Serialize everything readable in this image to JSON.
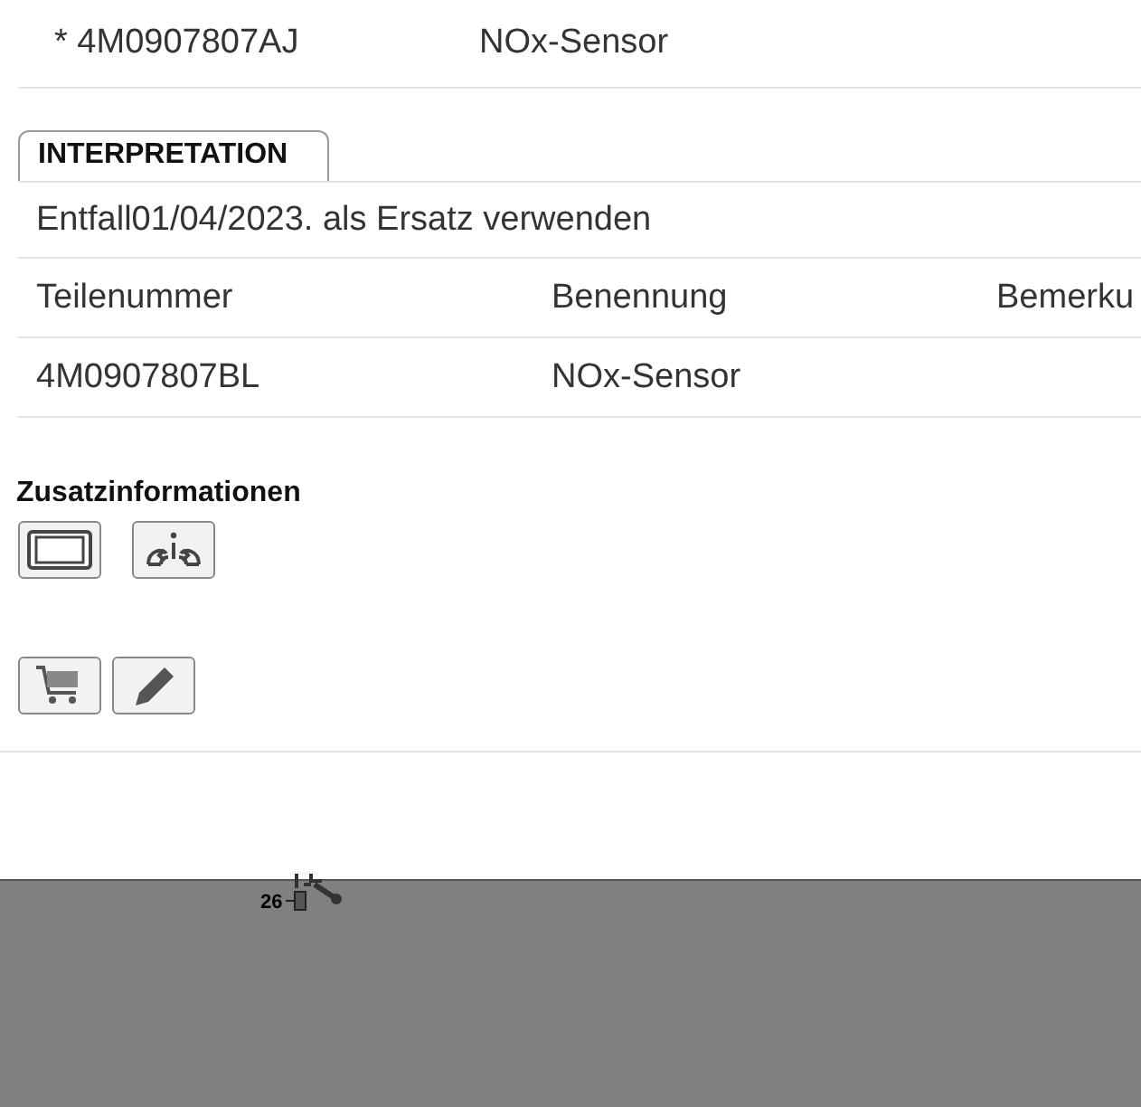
{
  "previous_part": {
    "number": "* 4M0907807AJ",
    "name": "NOx-Sensor"
  },
  "interpretation": {
    "tab": "INTERPRETATION",
    "note": "Entfall01/04/2023. als Ersatz verwenden",
    "columns": [
      "Teilenummer",
      "Benennung",
      "Bemerku"
    ],
    "rows": [
      [
        "4M0907807BL",
        "NOx-Sensor"
      ]
    ]
  },
  "additional_info": {
    "title": "Zusatzinformationen"
  },
  "diagram": {
    "callout": "26"
  }
}
